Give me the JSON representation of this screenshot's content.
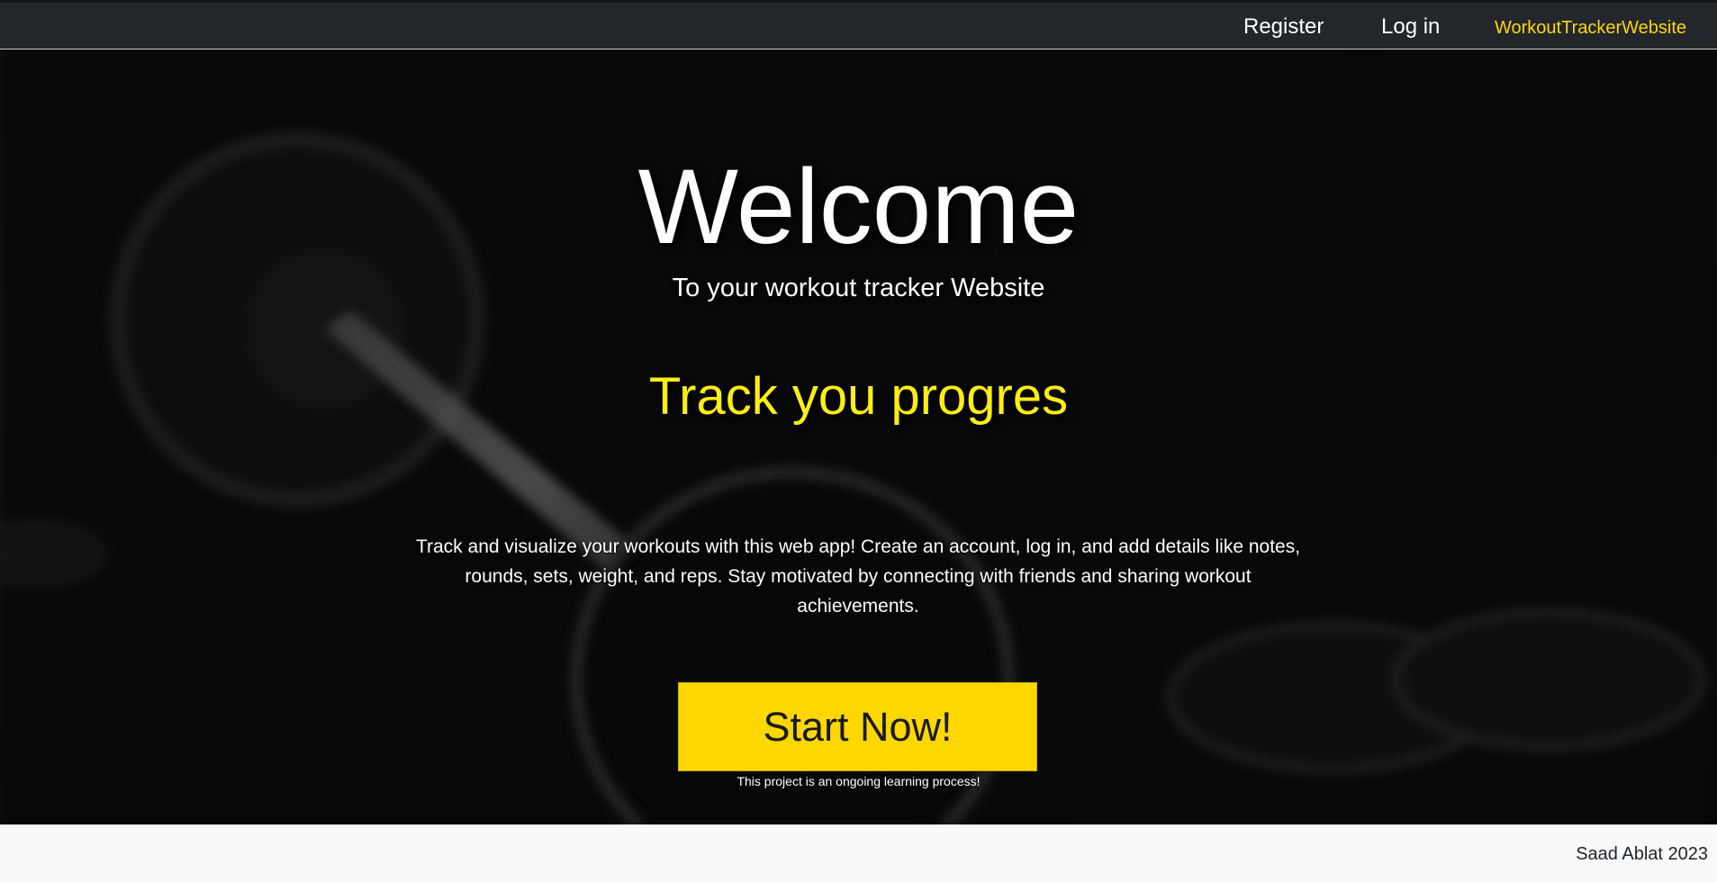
{
  "navbar": {
    "register_label": "Register",
    "login_label": "Log in",
    "brand": "WorkoutTrackerWebsite"
  },
  "hero": {
    "title": "Welcome",
    "subtitle": "To your workout tracker Website",
    "heading": "Track you progres",
    "description": "Track and visualize your workouts with this web app! Create an account, log in, and add details like notes, rounds, sets, weight, and reps. Stay motivated by connecting with friends and sharing workout achievements.",
    "cta_label": "Start Now!",
    "note": "This project is an ongoing learning process!"
  },
  "footer": {
    "text": "Saad Ablat 2023"
  },
  "colors": {
    "navbar_bg": "#23272c",
    "brand": "#ffd60a",
    "heading": "#ffee11",
    "cta_bg": "#ffd700",
    "footer_bg": "#f8f9fa"
  },
  "icons": [
    "barbell-background-image"
  ]
}
